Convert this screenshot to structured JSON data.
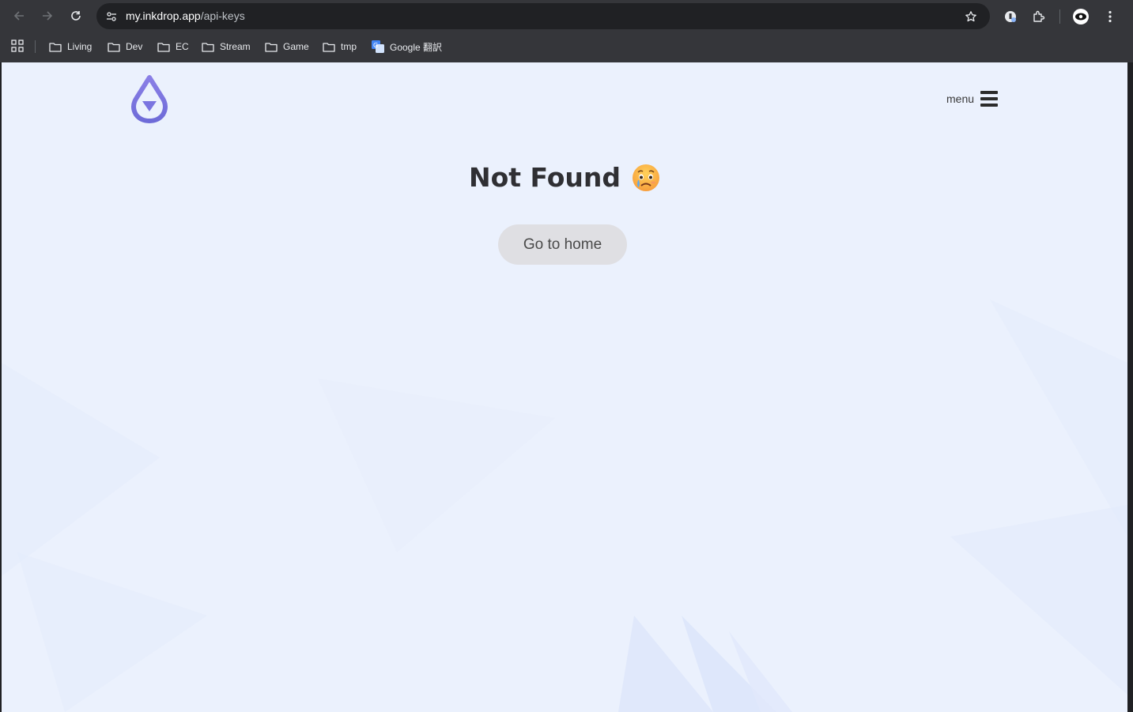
{
  "browser": {
    "url_host": "my.inkdrop.app",
    "url_path": "/api-keys",
    "bookmarks": [
      {
        "label": "Living"
      },
      {
        "label": "Dev"
      },
      {
        "label": "EC"
      },
      {
        "label": "Stream"
      },
      {
        "label": "Game"
      },
      {
        "label": "tmp"
      },
      {
        "label": "Google 翻訳"
      }
    ]
  },
  "page": {
    "menu_label": "menu",
    "title": "Not Found",
    "home_button": "Go to home"
  },
  "icons": {
    "logo": "inkdrop-logo",
    "emoji": "cry-face-emoji"
  }
}
